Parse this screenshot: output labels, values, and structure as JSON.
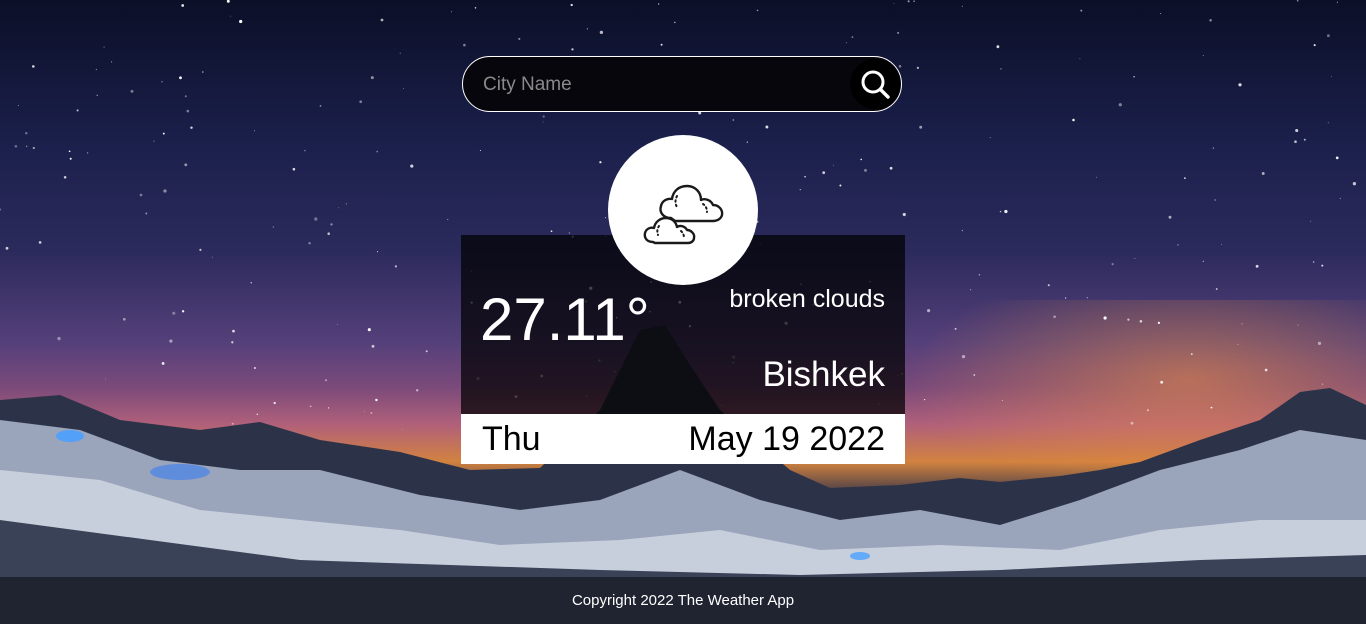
{
  "search": {
    "placeholder": "City Name",
    "value": "",
    "button_icon": "search-icon"
  },
  "weather": {
    "icon": "broken-clouds-icon",
    "temperature": "27.11°",
    "description": "broken clouds",
    "city": "Bishkek",
    "day": "Thu",
    "date": "May 19 2022"
  },
  "footer": {
    "text": "Copyright 2022 The Weather App"
  },
  "colors": {
    "card_background": "#000000",
    "card_footer": "#ffffff",
    "text_light": "#ffffff",
    "text_dark": "#000000"
  }
}
